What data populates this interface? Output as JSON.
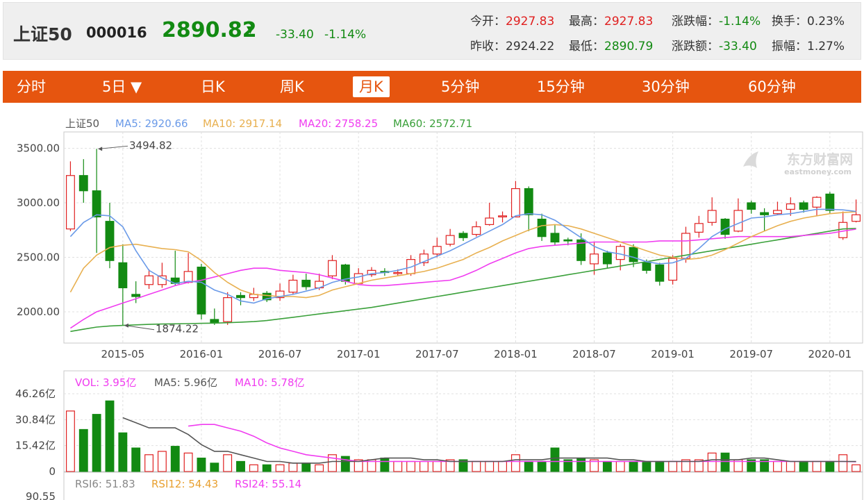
{
  "quote": {
    "name": "上证50",
    "code": "000016",
    "price": "2890.82",
    "arrow": "▼",
    "change": "-33.40",
    "change_pct": "-1.14%",
    "stats": [
      {
        "label": "今开：",
        "value": "2927.83",
        "dir": "up"
      },
      {
        "label": "最高：",
        "value": "2927.83",
        "dir": "up"
      },
      {
        "label": "涨跌幅：",
        "value": "-1.14%",
        "dir": "down"
      },
      {
        "label": "换手：",
        "value": "0.23%",
        "dir": "flat"
      },
      {
        "label": "昨收：",
        "value": "2924.22",
        "dir": "flat"
      },
      {
        "label": "最低：",
        "value": "2890.79",
        "dir": "down"
      },
      {
        "label": "涨跌额：",
        "value": "-33.40",
        "dir": "down"
      },
      {
        "label": "振幅：",
        "value": "1.27%",
        "dir": "flat"
      }
    ]
  },
  "tabs": [
    {
      "label": "分时",
      "active": false
    },
    {
      "label": "5日 ▼",
      "active": false
    },
    {
      "label": "日K",
      "active": false
    },
    {
      "label": "周K",
      "active": false
    },
    {
      "label": "月K",
      "active": true
    },
    {
      "label": "5分钟",
      "active": false
    },
    {
      "label": "15分钟",
      "active": false
    },
    {
      "label": "30分钟",
      "active": false
    },
    {
      "label": "60分钟",
      "active": false
    }
  ],
  "watermark": {
    "cn": "东方财富网",
    "en": "eastmoney.com"
  },
  "colors": {
    "up": "#e02020",
    "down": "#128a12",
    "accent": "#e6550f",
    "ma5": "#6a9ae8",
    "ma10": "#e8b050",
    "ma20": "#f03cf0",
    "ma60": "#3aa03a",
    "vol_ma5": "#555555",
    "vol_ma10": "#f03cf0",
    "rsi6": "#888888",
    "rsi12": "#e8a030",
    "rsi24": "#f03cf0"
  },
  "chart_data": [
    {
      "type": "candlestick",
      "series_name": "上证50",
      "legend": [
        {
          "label": "上证50",
          "value": ""
        },
        {
          "label": "MA5",
          "value": "2920.66"
        },
        {
          "label": "MA10",
          "value": "2917.14"
        },
        {
          "label": "MA20",
          "value": "2758.25"
        },
        {
          "label": "MA60",
          "value": "2572.71"
        }
      ],
      "y_ticks": [
        "3500.00",
        "3000.00",
        "2500.00",
        "2000.00"
      ],
      "ylim": [
        1800,
        3600
      ],
      "x_ticks": [
        "2015-05",
        "2016-01",
        "2016-07",
        "2017-01",
        "2017-07",
        "2018-01",
        "2018-07",
        "2019-01",
        "2019-07",
        "2020-01"
      ],
      "annotations": [
        {
          "label": "3494.82",
          "value": 3494.82
        },
        {
          "label": "1874.22",
          "value": 1874.22
        }
      ],
      "ohlc": [
        [
          2760,
          3250,
          3380,
          2740
        ],
        [
          3250,
          3110,
          3400,
          3000
        ],
        [
          3110,
          2870,
          3494.82,
          2540
        ],
        [
          2830,
          2470,
          3000,
          2400
        ],
        [
          2450,
          2220,
          2620,
          1874.22
        ],
        [
          2160,
          2140,
          2280,
          2080
        ],
        [
          2250,
          2330,
          2390,
          2210
        ],
        [
          2250,
          2330,
          2450,
          2220
        ],
        [
          2310,
          2260,
          2560,
          2240
        ],
        [
          2270,
          2370,
          2540,
          2260
        ],
        [
          2410,
          1980,
          2440,
          1930
        ],
        [
          1930,
          1900,
          2030,
          1880
        ],
        [
          1910,
          2130,
          2180,
          1880
        ],
        [
          2150,
          2130,
          2180,
          2060
        ],
        [
          2130,
          2160,
          2220,
          2100
        ],
        [
          2170,
          2110,
          2190,
          2090
        ],
        [
          2130,
          2190,
          2260,
          2100
        ],
        [
          2180,
          2290,
          2340,
          2160
        ],
        [
          2290,
          2230,
          2350,
          2200
        ],
        [
          2220,
          2280,
          2350,
          2200
        ],
        [
          2330,
          2470,
          2520,
          2300
        ],
        [
          2430,
          2280,
          2440,
          2250
        ],
        [
          2260,
          2350,
          2400,
          2250
        ],
        [
          2340,
          2380,
          2410,
          2320
        ],
        [
          2370,
          2360,
          2400,
          2330
        ],
        [
          2360,
          2360,
          2390,
          2330
        ],
        [
          2350,
          2480,
          2520,
          2330
        ],
        [
          2450,
          2530,
          2570,
          2420
        ],
        [
          2530,
          2600,
          2680,
          2500
        ],
        [
          2620,
          2700,
          2760,
          2600
        ],
        [
          2720,
          2680,
          2740,
          2650
        ],
        [
          2710,
          2780,
          2830,
          2690
        ],
        [
          2800,
          2860,
          3000,
          2790
        ],
        [
          2880,
          2880,
          2920,
          2820
        ],
        [
          2870,
          3130,
          3200,
          2870
        ],
        [
          3130,
          2890,
          3150,
          2740
        ],
        [
          2850,
          2690,
          2900,
          2650
        ],
        [
          2720,
          2640,
          2800,
          2610
        ],
        [
          2660,
          2650,
          2680,
          2610
        ],
        [
          2660,
          2470,
          2720,
          2430
        ],
        [
          2440,
          2530,
          2640,
          2340
        ],
        [
          2540,
          2440,
          2560,
          2400
        ],
        [
          2480,
          2600,
          2620,
          2380
        ],
        [
          2590,
          2460,
          2620,
          2410
        ],
        [
          2450,
          2380,
          2480,
          2350
        ],
        [
          2430,
          2280,
          2450,
          2240
        ],
        [
          2290,
          2490,
          2520,
          2250
        ],
        [
          2490,
          2720,
          2780,
          2450
        ],
        [
          2730,
          2810,
          2880,
          2680
        ],
        [
          2820,
          2930,
          3050,
          2790
        ],
        [
          2850,
          2710,
          2860,
          2670
        ],
        [
          2740,
          2930,
          3040,
          2730
        ],
        [
          3000,
          2940,
          3020,
          2900
        ],
        [
          2910,
          2890,
          2950,
          2740
        ],
        [
          2900,
          2930,
          3010,
          2890
        ],
        [
          2940,
          2990,
          3050,
          2880
        ],
        [
          3000,
          2940,
          3020,
          2910
        ],
        [
          2960,
          3050,
          3060,
          2880
        ],
        [
          3080,
          2930,
          3100,
          2900
        ],
        [
          2680,
          2820,
          2920,
          2660
        ],
        [
          2830,
          2890,
          3030,
          2820
        ]
      ],
      "ma5": [
        2690,
        2820,
        2890,
        2880,
        2780,
        2560,
        2380,
        2310,
        2260,
        2280,
        2270,
        2200,
        2160,
        2100,
        2080,
        2120,
        2140,
        2160,
        2190,
        2220,
        2270,
        2300,
        2320,
        2350,
        2360,
        2380,
        2410,
        2460,
        2510,
        2560,
        2620,
        2680,
        2740,
        2800,
        2880,
        2900,
        2890,
        2840,
        2760,
        2680,
        2600,
        2550,
        2530,
        2500,
        2460,
        2440,
        2450,
        2490,
        2580,
        2690,
        2760,
        2810,
        2860,
        2870,
        2890,
        2900,
        2920,
        2940,
        2940,
        2935,
        2920
      ],
      "ma10": [
        2180,
        2400,
        2520,
        2590,
        2610,
        2620,
        2600,
        2580,
        2570,
        2550,
        2470,
        2360,
        2270,
        2200,
        2160,
        2150,
        2140,
        2140,
        2130,
        2150,
        2200,
        2230,
        2260,
        2290,
        2310,
        2330,
        2350,
        2370,
        2400,
        2440,
        2480,
        2540,
        2590,
        2650,
        2700,
        2750,
        2790,
        2800,
        2790,
        2760,
        2720,
        2680,
        2640,
        2600,
        2560,
        2520,
        2500,
        2480,
        2490,
        2520,
        2570,
        2630,
        2690,
        2740,
        2790,
        2830,
        2860,
        2880,
        2900,
        2910,
        2917
      ],
      "ma20": [
        1850,
        1930,
        2000,
        2040,
        2080,
        2120,
        2160,
        2200,
        2240,
        2270,
        2290,
        2320,
        2350,
        2380,
        2400,
        2400,
        2380,
        2370,
        2360,
        2340,
        2310,
        2280,
        2250,
        2240,
        2240,
        2250,
        2260,
        2270,
        2280,
        2290,
        2330,
        2380,
        2440,
        2490,
        2540,
        2580,
        2600,
        2610,
        2620,
        2630,
        2640,
        2640,
        2640,
        2640,
        2640,
        2650,
        2650,
        2650,
        2660,
        2670,
        2680,
        2690,
        2690,
        2690,
        2690,
        2690,
        2700,
        2710,
        2720,
        2740,
        2758
      ],
      "ma60": [
        1820,
        1840,
        1860,
        1870,
        1875,
        1880,
        1885,
        1888,
        1890,
        1892,
        1894,
        1896,
        1900,
        1905,
        1910,
        1920,
        1935,
        1950,
        1965,
        1980,
        1995,
        2010,
        2025,
        2040,
        2060,
        2080,
        2100,
        2120,
        2140,
        2160,
        2180,
        2200,
        2220,
        2240,
        2260,
        2280,
        2300,
        2320,
        2340,
        2360,
        2380,
        2400,
        2420,
        2440,
        2460,
        2480,
        2500,
        2520,
        2540,
        2560,
        2580,
        2600,
        2620,
        2640,
        2660,
        2680,
        2700,
        2720,
        2740,
        2760,
        2572.71
      ]
    },
    {
      "type": "bar",
      "series_name": "VOL",
      "legend": [
        {
          "label": "VOL",
          "value": "3.95亿"
        },
        {
          "label": "MA5",
          "value": "5.96亿"
        },
        {
          "label": "MA10",
          "value": "5.78亿"
        }
      ],
      "y_ticks": [
        "46.26亿",
        "30.84亿",
        "15.42亿",
        "0"
      ],
      "ylim": [
        0,
        46.26
      ],
      "values": [
        36,
        25,
        34,
        42,
        23,
        14,
        10,
        12,
        15,
        11,
        8,
        5,
        10,
        6,
        4,
        4,
        4,
        5,
        5,
        4,
        10,
        9,
        7,
        7,
        8,
        6,
        6,
        6,
        6,
        7,
        7,
        6,
        6,
        6,
        10,
        6,
        6,
        14,
        7,
        8,
        7,
        6,
        6,
        6,
        6,
        6,
        6,
        7,
        7,
        11,
        11,
        7,
        7,
        7,
        6,
        6,
        6,
        6,
        6,
        10,
        4
      ],
      "ma5": [
        null,
        null,
        null,
        null,
        32,
        29,
        26,
        26,
        26,
        22,
        16,
        12,
        12,
        10,
        8,
        6,
        6,
        5,
        5,
        5,
        6,
        6,
        6,
        7,
        8,
        8,
        8,
        7,
        7,
        6,
        6,
        6,
        6,
        6,
        7,
        7,
        7,
        8,
        8,
        8,
        8,
        8,
        7,
        7,
        6,
        6,
        6,
        6,
        6,
        7,
        7,
        7,
        8,
        8,
        7,
        6,
        6,
        6,
        6,
        6,
        5.96
      ],
      "ma10": [
        null,
        null,
        null,
        null,
        null,
        null,
        null,
        null,
        null,
        27,
        28,
        28,
        26,
        24,
        21,
        17,
        14,
        12,
        10,
        9,
        8,
        7,
        6,
        6,
        6,
        6,
        6,
        6,
        6,
        6,
        6,
        6,
        6,
        6,
        6,
        6,
        6,
        6,
        6,
        6,
        6,
        6,
        6,
        6,
        6,
        6,
        6,
        6,
        6,
        6,
        6,
        6,
        6,
        6,
        6,
        6,
        6,
        6,
        6,
        6,
        5.78
      ]
    },
    {
      "type": "line",
      "series_name": "RSI",
      "legend": [
        {
          "label": "RSI6",
          "value": "51.83"
        },
        {
          "label": "RSI12",
          "value": "54.43"
        },
        {
          "label": "RSI24",
          "value": "55.14"
        }
      ],
      "y_ticks": [
        "90.55"
      ]
    }
  ]
}
